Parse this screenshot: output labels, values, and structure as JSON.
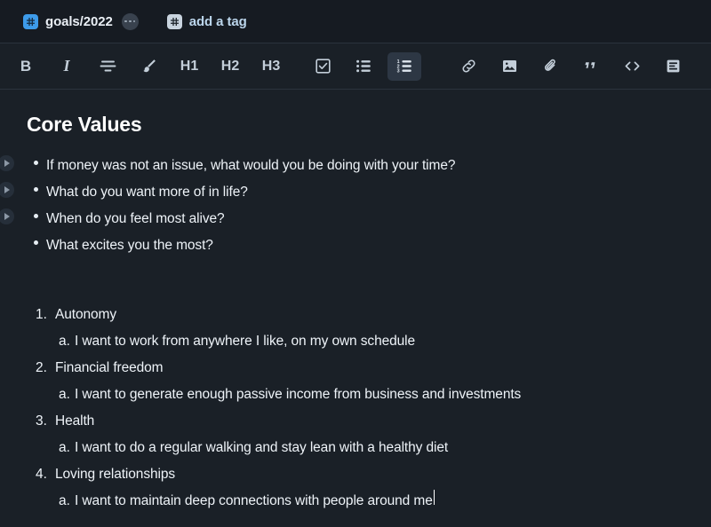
{
  "theme": {
    "header_bg": "#161b22",
    "body_bg": "#1a2027",
    "border": "#2b333d",
    "text": "#eef3f8",
    "accent": "#3d9bea",
    "tag_accent_text": "#bcd6ec",
    "icon": "#c3ced9",
    "active_btn_bg": "#2d3744"
  },
  "tagbar": {
    "tag": {
      "icon": "hash-icon",
      "label": "goals/2022"
    },
    "more_button": {
      "icon": "ellipsis-icon",
      "label": "..."
    },
    "add_tag": {
      "icon": "hash-icon",
      "label": "add a tag"
    }
  },
  "toolbar": {
    "groups": [
      {
        "name": "formatting",
        "buttons": [
          {
            "name": "bold-button",
            "icon": "bold-icon",
            "label": "B",
            "active": false
          },
          {
            "name": "italic-button",
            "icon": "italic-icon",
            "label": "I",
            "active": false
          },
          {
            "name": "strikethrough-button",
            "icon": "strikethrough-icon",
            "label": "",
            "active": false
          },
          {
            "name": "highlight-button",
            "icon": "brush-icon",
            "label": "",
            "active": false
          },
          {
            "name": "heading1-button",
            "icon": "h1-icon",
            "label": "H1",
            "active": false
          },
          {
            "name": "heading2-button",
            "icon": "h2-icon",
            "label": "H2",
            "active": false
          },
          {
            "name": "heading3-button",
            "icon": "h3-icon",
            "label": "H3",
            "active": false
          }
        ]
      },
      {
        "name": "lists",
        "buttons": [
          {
            "name": "task-list-button",
            "icon": "checkbox-icon",
            "label": "",
            "active": false
          },
          {
            "name": "bullet-list-button",
            "icon": "bullet-list-icon",
            "label": "",
            "active": false
          },
          {
            "name": "numbered-list-button",
            "icon": "numbered-list-icon",
            "label": "",
            "active": true
          }
        ]
      },
      {
        "name": "insert",
        "buttons": [
          {
            "name": "link-button",
            "icon": "link-icon",
            "label": "",
            "active": false
          },
          {
            "name": "image-button",
            "icon": "image-icon",
            "label": "",
            "active": false
          },
          {
            "name": "attachment-button",
            "icon": "paperclip-icon",
            "label": "",
            "active": false
          },
          {
            "name": "quote-button",
            "icon": "quote-icon",
            "label": "",
            "active": false
          },
          {
            "name": "code-button",
            "icon": "code-icon",
            "label": "",
            "active": false
          },
          {
            "name": "text-block-button",
            "icon": "document-icon",
            "label": "",
            "active": false
          }
        ]
      },
      {
        "name": "history",
        "buttons": [
          {
            "name": "undo-button",
            "icon": "undo-icon",
            "label": "",
            "active": false
          },
          {
            "name": "redo-button",
            "icon": "redo-icon",
            "label": "",
            "active": false
          },
          {
            "name": "sync-button",
            "icon": "sync-icon",
            "label": "",
            "active": false
          }
        ]
      }
    ]
  },
  "document": {
    "title": "Core Values",
    "bullets": [
      {
        "text": "If money was not an issue, what would you be doing with your time?",
        "foldable": true
      },
      {
        "text": "What do you want more of in life?",
        "foldable": true
      },
      {
        "text": "When do you feel most alive?",
        "foldable": true
      },
      {
        "text": "What excites you the most?",
        "foldable": false
      }
    ],
    "ordered": [
      {
        "marker": "1.",
        "text": "Autonomy",
        "sub_marker": "a.",
        "sub_text": "I want to work from anywhere I like, on my own schedule",
        "cursor": false
      },
      {
        "marker": "2.",
        "text": "Financial freedom",
        "sub_marker": "a.",
        "sub_text": "I want to generate enough passive income from business and investments",
        "cursor": false
      },
      {
        "marker": "3.",
        "text": "Health",
        "sub_marker": "a.",
        "sub_text": "I want to do a regular walking and stay lean with a healthy diet",
        "cursor": false
      },
      {
        "marker": "4.",
        "text": "Loving relationships",
        "sub_marker": "a.",
        "sub_text": "I want to maintain deep connections with people around me",
        "cursor": true
      }
    ]
  }
}
